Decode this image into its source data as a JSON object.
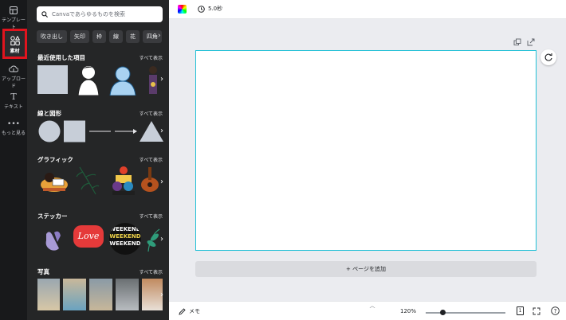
{
  "rail": {
    "items": [
      {
        "label": "テンプレート",
        "icon": "template-icon"
      },
      {
        "label": "素材",
        "icon": "elements-icon"
      },
      {
        "label": "アップロード",
        "icon": "upload-icon"
      },
      {
        "label": "テキスト",
        "icon": "text-icon"
      },
      {
        "label": "もっと見る",
        "icon": "more-icon"
      }
    ],
    "active_index": 1,
    "highlight_color": "#e0141e"
  },
  "panel": {
    "search_placeholder": "Canvaであらゆるものを検索",
    "chips": [
      "吹き出し",
      "矢印",
      "枠",
      "線",
      "花",
      "四角"
    ],
    "see_all": "すべて表示",
    "sections": [
      {
        "title": "最近使用した項目"
      },
      {
        "title": "線と図形"
      },
      {
        "title": "グラフィック"
      },
      {
        "title": "ステッカー"
      },
      {
        "title": "写真"
      }
    ],
    "sticker_love_text": "Love",
    "sticker_weekend_text": "WEEKEND"
  },
  "topbar": {
    "timer": "5.0秒"
  },
  "canvas": {
    "add_page": "+ ページを追加",
    "page_border_color": "#22c0d6"
  },
  "bottombar": {
    "memo": "メモ",
    "zoom": "120%",
    "page_count": "1",
    "zoom_fraction": 0.18
  }
}
